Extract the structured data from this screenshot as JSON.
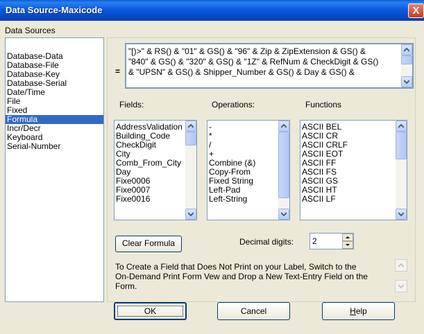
{
  "window": {
    "title": "Data Source-Maxicode",
    "close_glyph": "X"
  },
  "data_sources": {
    "label": "Data Sources",
    "items": [
      {
        "label": "Database-Data",
        "selected": false
      },
      {
        "label": "Database-File",
        "selected": false
      },
      {
        "label": "Database-Key",
        "selected": false
      },
      {
        "label": "Database-Serial",
        "selected": false
      },
      {
        "label": "Date/Time",
        "selected": false
      },
      {
        "label": "File",
        "selected": false
      },
      {
        "label": "Fixed",
        "selected": false
      },
      {
        "label": "Formula",
        "selected": true
      },
      {
        "label": "Incr/Decr",
        "selected": false
      },
      {
        "label": "Keyboard",
        "selected": false
      },
      {
        "label": "Serial-Number",
        "selected": false
      }
    ]
  },
  "formula": {
    "equals": "=",
    "lines": [
      "\"[)>\" & RS() & \"01\" & GS() & \"96\" & Zip & ZipExtension & GS() &",
      "\"840\" & GS() & \"320\" & GS() & \"1Z\" & RefNum & CheckDigit & GS()",
      "& \"UPSN\" & GS() & Shipper_Number & GS() & Day & GS() &"
    ]
  },
  "fields": {
    "label": "Fields:",
    "items": [
      "AddressValidation",
      "Building_Code",
      "CheckDigit",
      "City",
      "Comb_From_City",
      "Day",
      "Fixe0006",
      "Fixe0007",
      "Fixe0016"
    ]
  },
  "operations": {
    "label": "Operations:",
    "items": [
      "-",
      "*",
      "/",
      "+",
      "Combine (&)",
      "Copy-From",
      "Fixed String",
      "Left-Pad",
      "Left-String"
    ]
  },
  "functions": {
    "label": "Functions",
    "items": [
      "ASCII BEL",
      "ASCII CR",
      "ASCII CRLF",
      "ASCII EOT",
      "ASCII FF",
      "ASCII FS",
      "ASCII GS",
      "ASCII HT",
      "ASCII LF"
    ]
  },
  "clear_formula_label": "Clear Formula",
  "decimal_digits": {
    "label": "Decimal digits:",
    "value": "2"
  },
  "info_text": {
    "lines": [
      "To Create a Field that Does Not Print on your Label, Switch to the",
      "On-Demand Print Form Vew and Drop a New Text-Entry Field on the",
      "Form."
    ]
  },
  "buttons": {
    "ok": "OK",
    "cancel": "Cancel",
    "help": "Help"
  }
}
